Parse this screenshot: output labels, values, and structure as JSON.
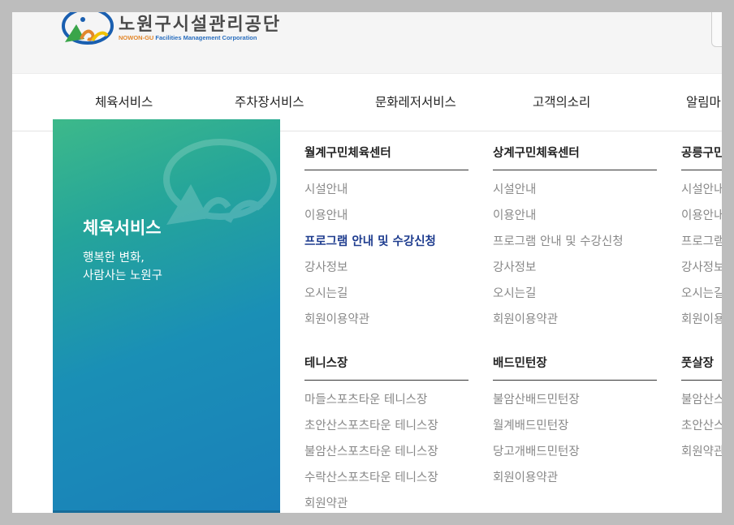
{
  "header": {
    "logo_kor": "노원구시설관리공단",
    "logo_eng_nowon": "NOWON-GU",
    "logo_eng_rest": "Facilities  Management Corporation"
  },
  "gnb": [
    "체육서비스",
    "주차장서비스",
    "문화레저서비스",
    "고객의소리",
    "알림마당"
  ],
  "panel": {
    "title": "체육서비스",
    "sub_line1": "행복한 변화,",
    "sub_line2": "사람사는 노원구"
  },
  "menus": [
    {
      "title": "월계구민체육센터",
      "links": [
        "시설안내",
        "이용안내",
        "프로그램 안내 및 수강신청",
        "강사정보",
        "오시는길",
        "회원이용약관"
      ],
      "active_index": 2
    },
    {
      "title": "상계구민체육센터",
      "links": [
        "시설안내",
        "이용안내",
        "프로그램 안내 및 수강신청",
        "강사정보",
        "오시는길",
        "회원이용약관"
      ]
    },
    {
      "title": "공릉구민체육센터",
      "links": [
        "시설안내",
        "이용안내",
        "프로그램 안내 및 수강신청",
        "강사정보",
        "오시는길",
        "회원이용약관"
      ]
    },
    {
      "title": "테니스장",
      "links": [
        "마들스포츠타운 테니스장",
        "초안산스포츠타운 테니스장",
        "불암산스포츠타운 테니스장",
        "수락산스포츠타운 테니스장",
        "회원약관"
      ]
    },
    {
      "title": "배드민턴장",
      "links": [
        "불암산배드민턴장",
        "월계배드민턴장",
        "당고개배드민턴장",
        "회원이용약관"
      ]
    },
    {
      "title": "풋살장",
      "links": [
        "불암산스포츠타운 풋살장",
        "초안산스포츠타운 풋살장",
        "회원약관"
      ]
    }
  ],
  "colors": {
    "active_link": "#1f3d8f",
    "panel_gradient_top": "#3db98a",
    "panel_gradient_bottom": "#1a7fba"
  }
}
